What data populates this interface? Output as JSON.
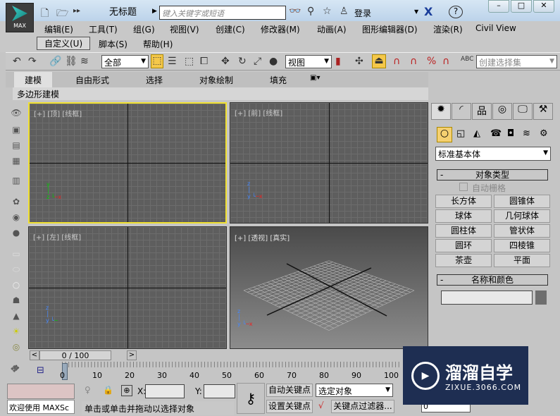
{
  "app": {
    "logo_text": "MAX",
    "title": "无标题",
    "search_placeholder": "键入关键字或短语",
    "login": "登录"
  },
  "menu": [
    "编辑(E)",
    "工具(T)",
    "组(G)",
    "视图(V)",
    "创建(C)",
    "修改器(M)",
    "动画(A)",
    "图形编辑器(D)",
    "渲染(R)",
    "Civil View",
    "自定义(U)",
    "脚本(S)",
    "帮助(H)"
  ],
  "toolbar": {
    "filter": "全部",
    "coord": "视图",
    "selection_set_placeholder": "创建选择集"
  },
  "ribbon": {
    "tabs": [
      "建模",
      "自由形式",
      "选择",
      "对象绘制",
      "填充"
    ],
    "subtab": "多边形建模"
  },
  "viewports": [
    {
      "label": "[+] [顶] [线框]",
      "active": true
    },
    {
      "label": "[+] [前] [线框]"
    },
    {
      "label": "[+] [左] [线框]"
    },
    {
      "label": "[+] [透视] [真实]"
    }
  ],
  "command_panel": {
    "category": "标准基本体",
    "rollout_object_type": "对象类型",
    "autogrid": "自动栅格",
    "autogrid_checked": false,
    "buttons": [
      "长方体",
      "圆锥体",
      "球体",
      "几何球体",
      "圆柱体",
      "管状体",
      "圆环",
      "四棱锥",
      "茶壶",
      "平面"
    ],
    "rollout_name_color": "名称和颜色",
    "name_value": "",
    "color": "#6e6e6e"
  },
  "timeline": {
    "frame_display": "0 / 100",
    "ticks": [
      "0",
      "10",
      "20",
      "30",
      "40",
      "50",
      "60",
      "70",
      "80",
      "90",
      "100"
    ]
  },
  "status": {
    "script_text": "欢迎使用 MAXSc",
    "prompt": "单击或单击并拖动以选择对象",
    "x_label": "X:",
    "y_label": "Y:",
    "x_value": "",
    "y_value": "",
    "auto_key": "自动关键点",
    "set_key": "设置关键点",
    "key_mode": "选定对象",
    "key_filters": "关键点过滤器...",
    "frame": "0"
  },
  "watermark": {
    "brand": "溜溜自学",
    "url": "ZIXUE.3066.COM"
  },
  "colors": {
    "active_viewport": "#f0e030",
    "viewport_bg": "#5e5e5e"
  }
}
